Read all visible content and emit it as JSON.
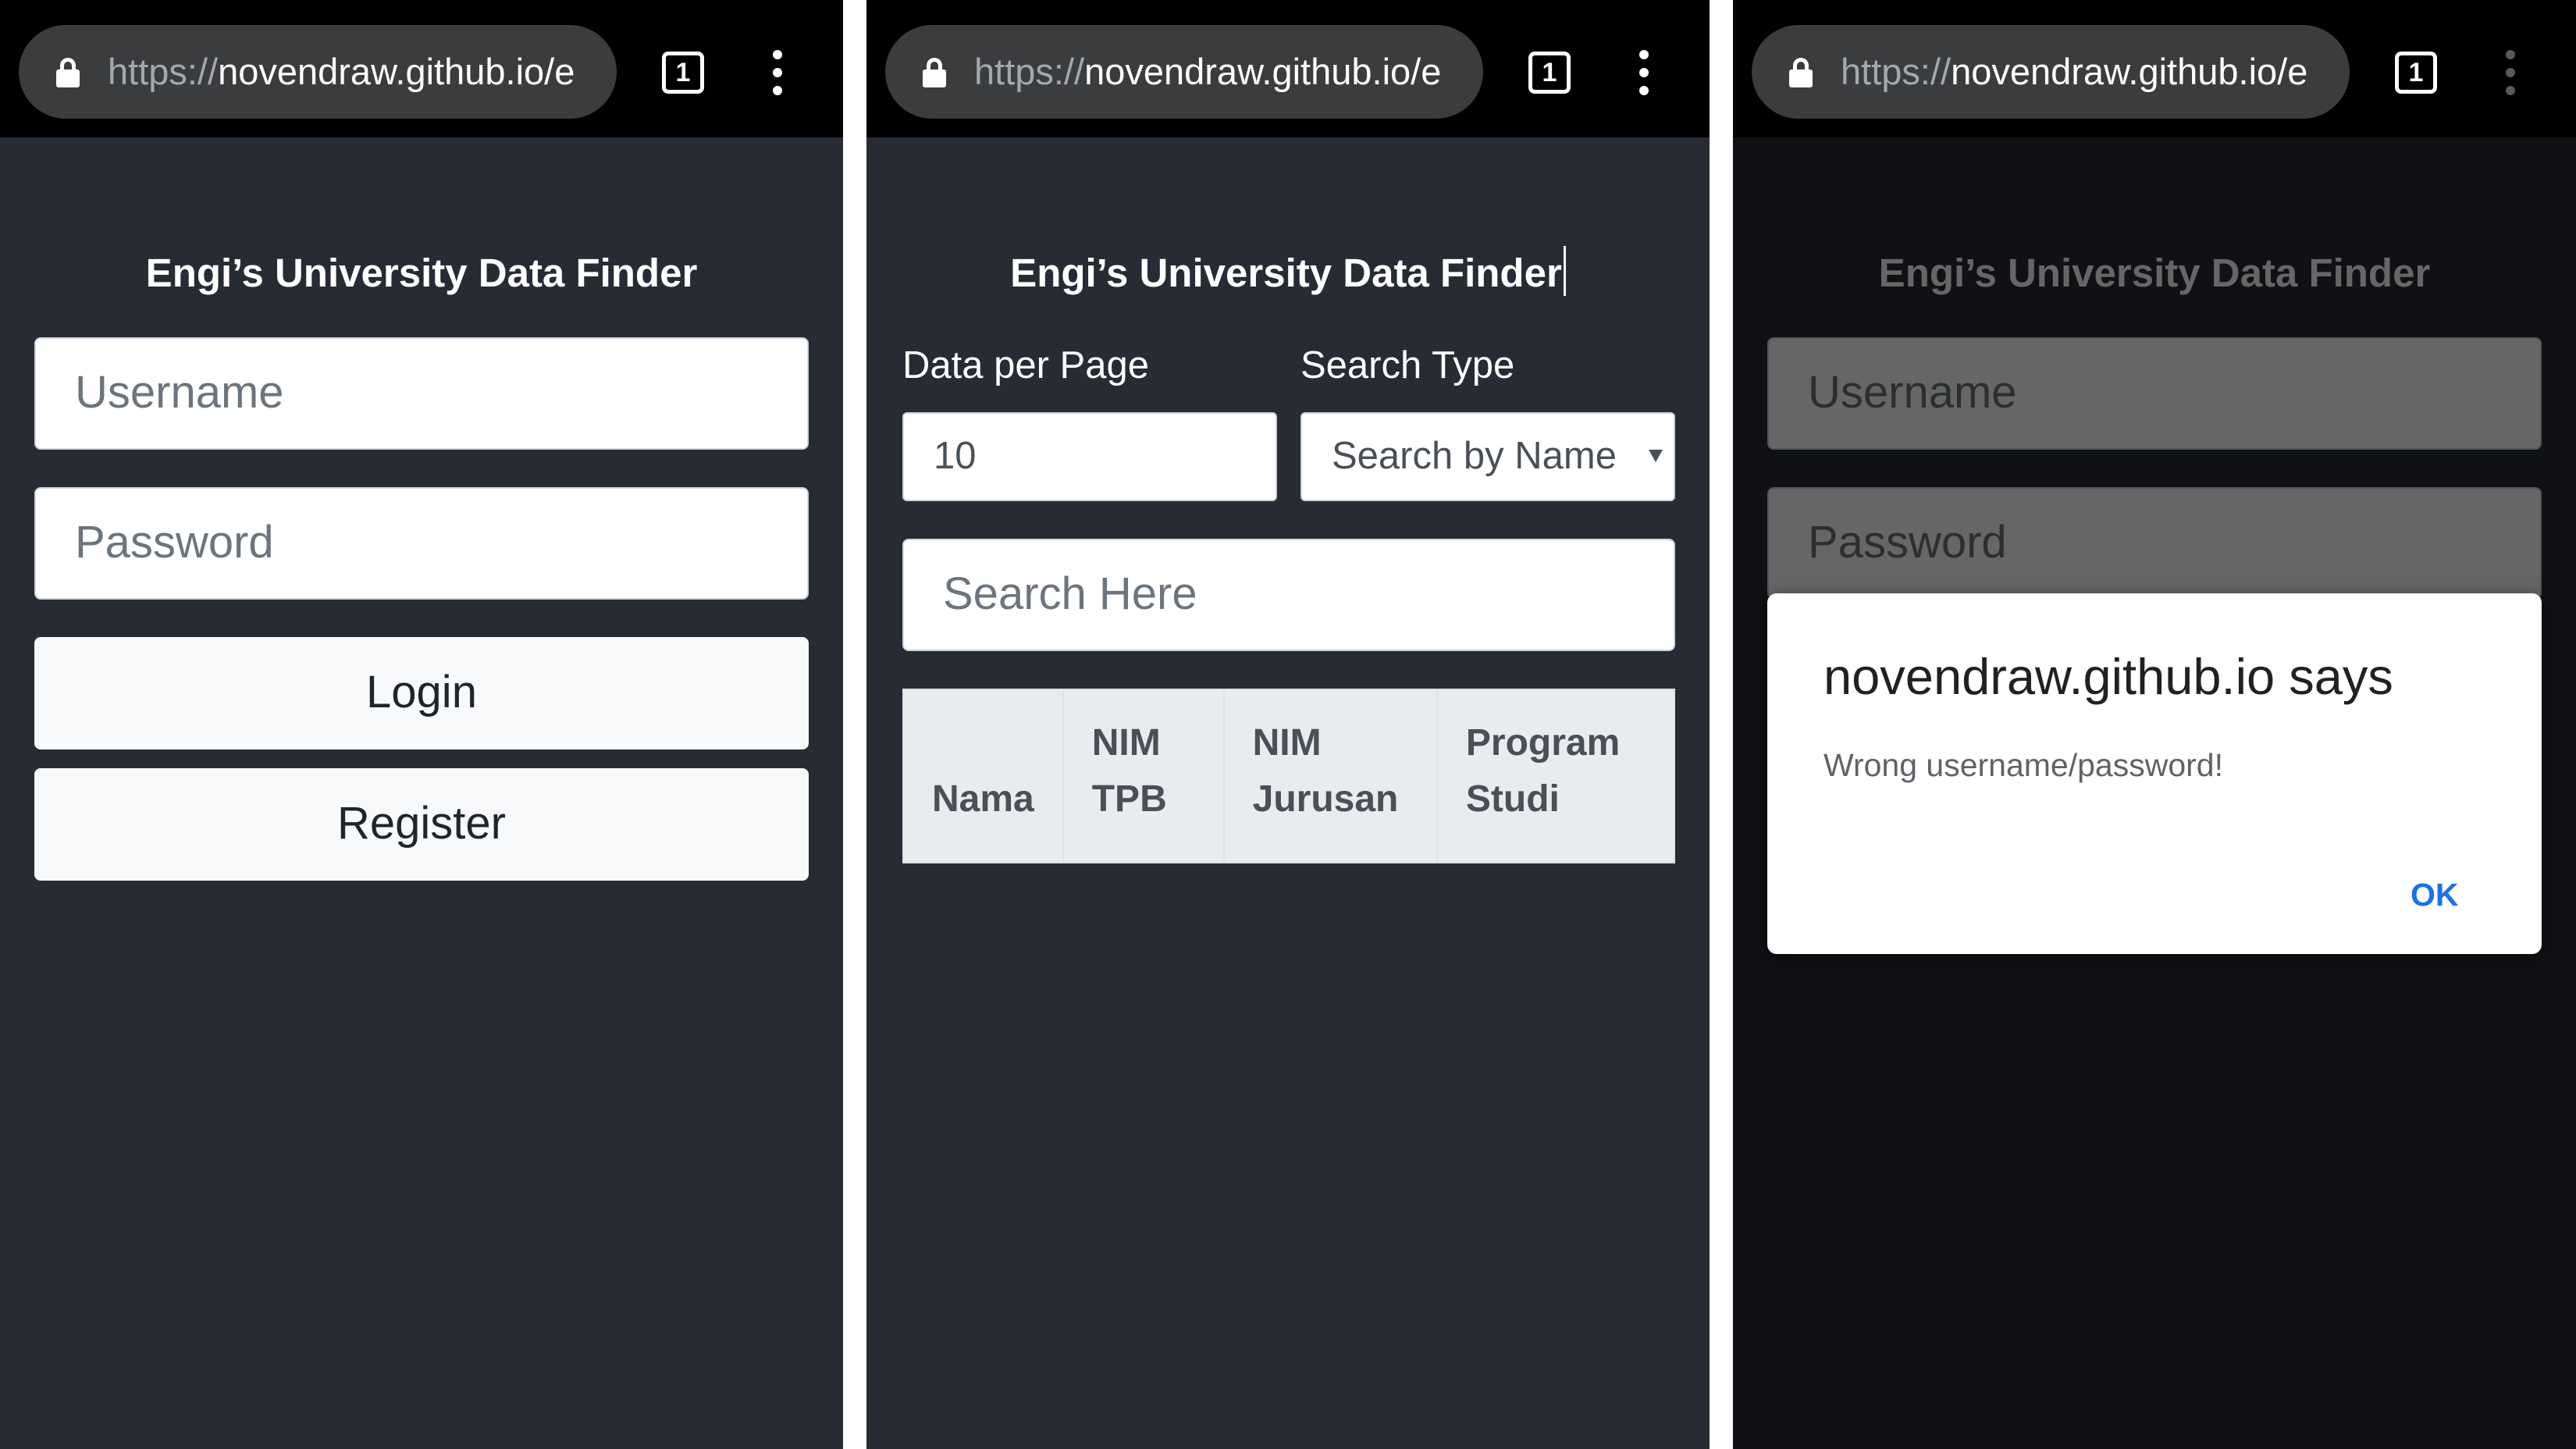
{
  "browser": {
    "url_scheme": "https://",
    "url_host": "novendraw.github.io/e",
    "tab_count": "1"
  },
  "app_title": "Engi’s University Data Finder",
  "login": {
    "username_placeholder": "Username",
    "password_placeholder": "Password",
    "login_label": "Login",
    "register_label": "Register"
  },
  "finder": {
    "data_per_page_label": "Data per Page",
    "data_per_page_value": "10",
    "search_type_label": "Search Type",
    "search_type_value": "Search by Name",
    "search_placeholder": "Search Here",
    "table_headers": [
      {
        "line1": "Nama",
        "line2": ""
      },
      {
        "line1": "NIM",
        "line2": "TPB"
      },
      {
        "line1": "NIM",
        "line2": "Jurusan"
      },
      {
        "line1": "Program",
        "line2": "Studi"
      }
    ]
  },
  "dialog": {
    "title": "novendraw.github.io says",
    "message": "Wrong username/password!",
    "ok_label": "OK"
  },
  "colors": {
    "page_background": "#272b33",
    "browser_bar": "#000000",
    "dialog_button": "#1a73e8"
  }
}
